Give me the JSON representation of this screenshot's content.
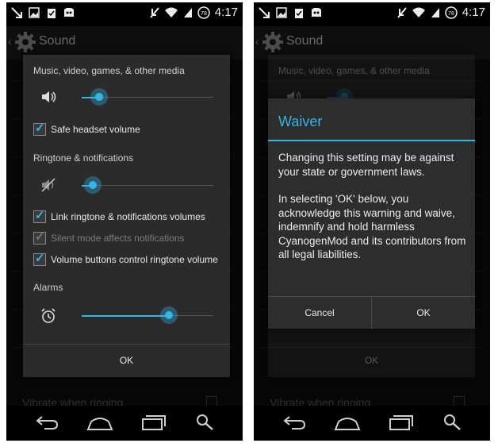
{
  "status_bar": {
    "time": "4:17",
    "battery": "78"
  },
  "action_bar": {
    "title": "Sound"
  },
  "background": {
    "vibrate_label": "Vibrate when ringing"
  },
  "volumes_dialog": {
    "media_label": "Music, video, games, & other media",
    "media_level": 0.05,
    "safe_headset_label": "Safe headset volume",
    "safe_headset_checked": true,
    "ringtone_label": "Ringtone & notifications",
    "ringtone_level": 0.0,
    "link_volumes_label": "Link ringtone & notifications volumes",
    "link_volumes_checked": true,
    "silent_mode_label": "Silent mode affects notifications",
    "silent_mode_checked": true,
    "silent_mode_enabled": false,
    "volume_buttons_label": "Volume buttons control ringtone volume",
    "volume_buttons_checked": true,
    "alarms_label": "Alarms",
    "alarm_level": 0.58,
    "ok_label": "OK"
  },
  "waiver_dialog": {
    "title": "Waiver",
    "paragraph_1": "Changing this setting may be against your state or government laws.",
    "paragraph_2": "In selecting 'OK' below, you acknowledge this warning and waive, indemnify and hold harmless CyanogenMod and its contributors from all legal liabilities.",
    "cancel_label": "Cancel",
    "ok_label": "OK"
  },
  "colors": {
    "accent": "#33b5e5",
    "dialog_bg": "#2b2b2b",
    "screen_bg": "#101010"
  }
}
